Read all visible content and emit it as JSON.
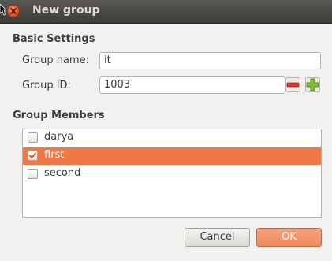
{
  "window": {
    "title": "New group"
  },
  "basic_settings": {
    "heading": "Basic Settings",
    "group_name_label": "Group name:",
    "group_name_value": "it",
    "group_id_label": "Group ID:",
    "group_id_value": "1003"
  },
  "group_members": {
    "heading": "Group Members",
    "members": [
      {
        "name": "darya",
        "checked": false,
        "selected": false
      },
      {
        "name": "first",
        "checked": true,
        "selected": true
      },
      {
        "name": "second",
        "checked": false,
        "selected": false
      }
    ]
  },
  "buttons": {
    "cancel": "Cancel",
    "ok": "OK"
  },
  "colors": {
    "accent": "#f07746",
    "titlebar": "#3c3b37"
  },
  "icons": {
    "close": "close-icon",
    "decrement": "minus-icon",
    "increment": "plus-icon",
    "checkbox": "checkbox-icon"
  }
}
